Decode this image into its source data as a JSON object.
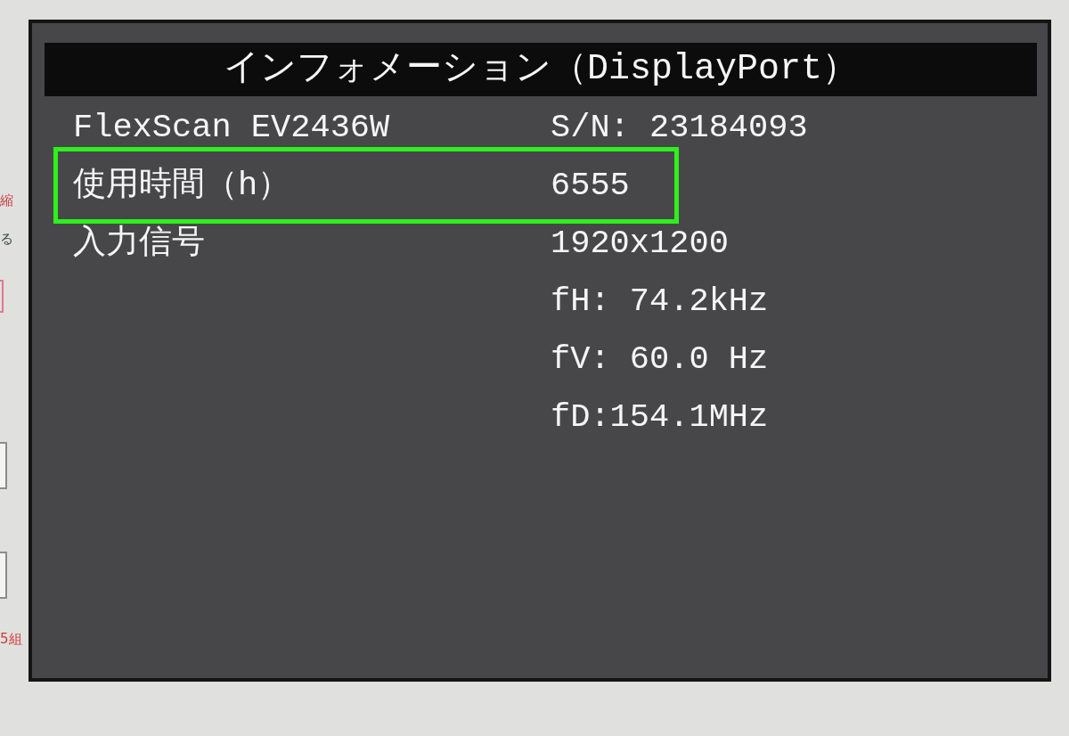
{
  "background_page": {
    "items": [
      {
        "kind": "text",
        "text": "縮",
        "color": "#c8393b"
      },
      {
        "kind": "text",
        "text": "る",
        "color": "#3d4d4b"
      },
      {
        "kind": "field",
        "color": "#e07a8e"
      },
      {
        "kind": "field",
        "color": "#8c8c8c"
      },
      {
        "kind": "field",
        "color": "#8c8c8c"
      },
      {
        "kind": "text",
        "text": "5組",
        "color": "#cf3b35"
      }
    ]
  },
  "osd": {
    "title": "インフォメーション（DisplayPort）",
    "rows": [
      {
        "label": "FlexScan EV2436W",
        "value": "S/N: 23184093",
        "highlighted": false
      },
      {
        "label": "使用時間（h）",
        "value": "6555",
        "highlighted": true
      },
      {
        "label": "入力信号",
        "value": "1920x1200",
        "highlighted": false
      },
      {
        "value": "fH: 74.2kHz",
        "highlighted": false
      },
      {
        "value": "fV: 60.0 Hz",
        "highlighted": false
      },
      {
        "value": "fD:154.1MHz",
        "highlighted": false
      }
    ]
  }
}
